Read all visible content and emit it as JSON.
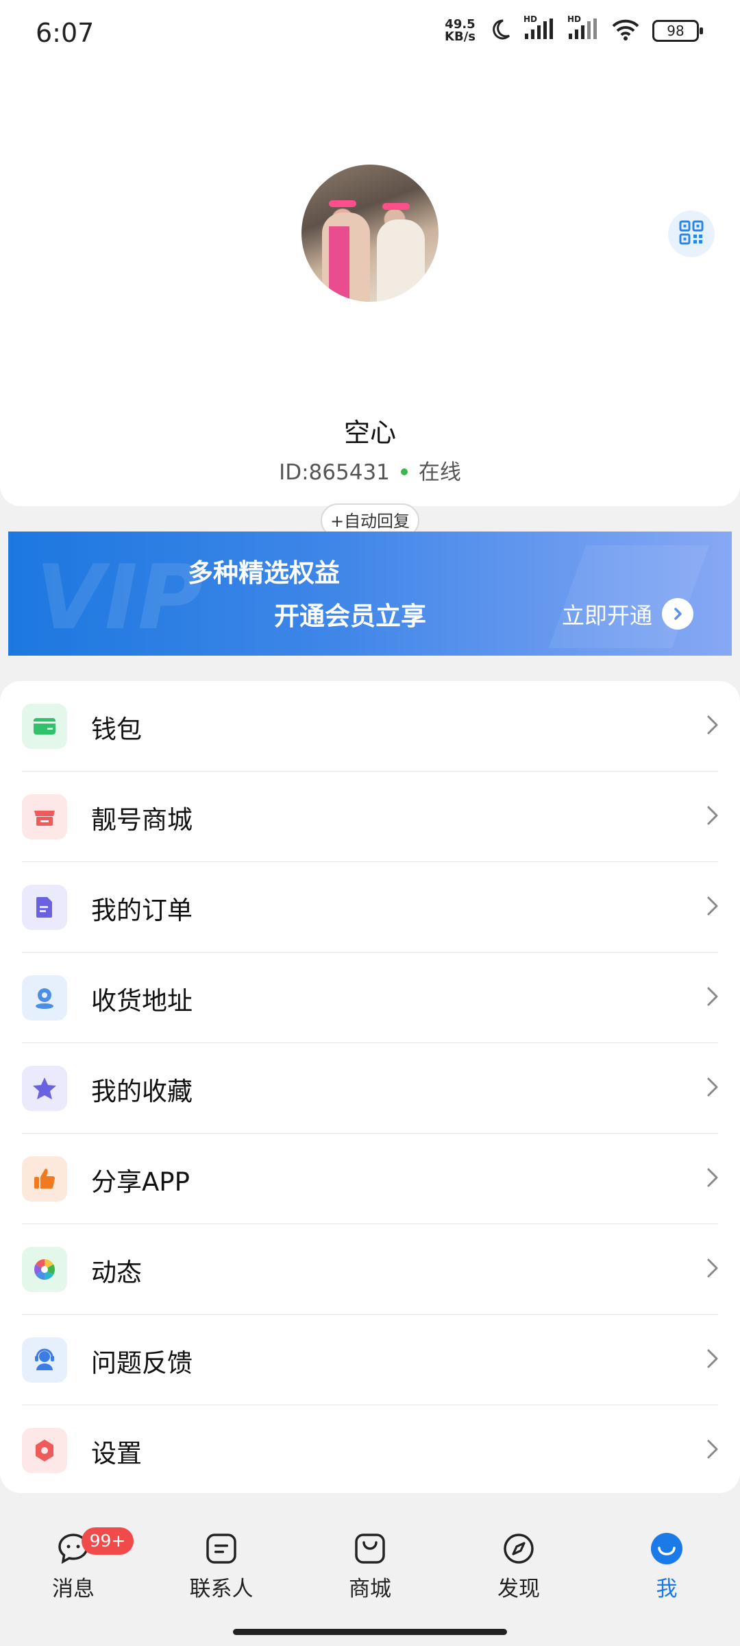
{
  "status_bar": {
    "time": "6:07",
    "net_speed_value": "49.5",
    "net_speed_unit": "KB/s",
    "signal1_label": "HD",
    "signal2_label": "HD",
    "battery": "98",
    "icons": [
      "moon-icon",
      "signal-icon",
      "signal-icon",
      "wifi-icon",
      "battery-icon"
    ]
  },
  "profile": {
    "name": "空心",
    "id_text": "ID:865431",
    "status": "在线",
    "status_color": "#3cb64a",
    "auto_reply_label": "+自动回复"
  },
  "vip_banner": {
    "line1": "多种精选权益",
    "line2": "开通会员立享",
    "cta": "立即开通",
    "watermark": "VIP"
  },
  "menu": {
    "items": [
      {
        "label": "钱包",
        "icon": "wallet-icon",
        "color": "#2fc26b",
        "bg": "#e3f7ea"
      },
      {
        "label": "靓号商城",
        "icon": "store-icon",
        "color": "#ef5b5b",
        "bg": "#fde7e7"
      },
      {
        "label": "我的订单",
        "icon": "order-icon",
        "color": "#6a61e0",
        "bg": "#ebeafc"
      },
      {
        "label": "收货地址",
        "icon": "location-icon",
        "color": "#4a8fe6",
        "bg": "#e6f0fc"
      },
      {
        "label": "我的收藏",
        "icon": "star-icon",
        "color": "#6a61e0",
        "bg": "#ebeafc"
      },
      {
        "label": "分享APP",
        "icon": "thumbs-up-icon",
        "color": "#f17a21",
        "bg": "#fde9db"
      },
      {
        "label": "动态",
        "icon": "moments-icon",
        "color": "#3cb64a",
        "bg": "#e3f7ea"
      },
      {
        "label": "问题反馈",
        "icon": "support-agent-icon",
        "color": "#3c7ce6",
        "bg": "#e6f0fc"
      },
      {
        "label": "设置",
        "icon": "settings-icon",
        "color": "#ef5b5b",
        "bg": "#fde7e7"
      }
    ]
  },
  "tabbar": {
    "tabs": [
      {
        "label": "消息",
        "icon": "chat-icon",
        "badge": "99+"
      },
      {
        "label": "联系人",
        "icon": "contacts-icon"
      },
      {
        "label": "商城",
        "icon": "shopping-bag-icon"
      },
      {
        "label": "发现",
        "icon": "compass-icon"
      },
      {
        "label": "我",
        "icon": "me-icon",
        "active": true
      }
    ],
    "active_color": "#1a7ae8"
  }
}
